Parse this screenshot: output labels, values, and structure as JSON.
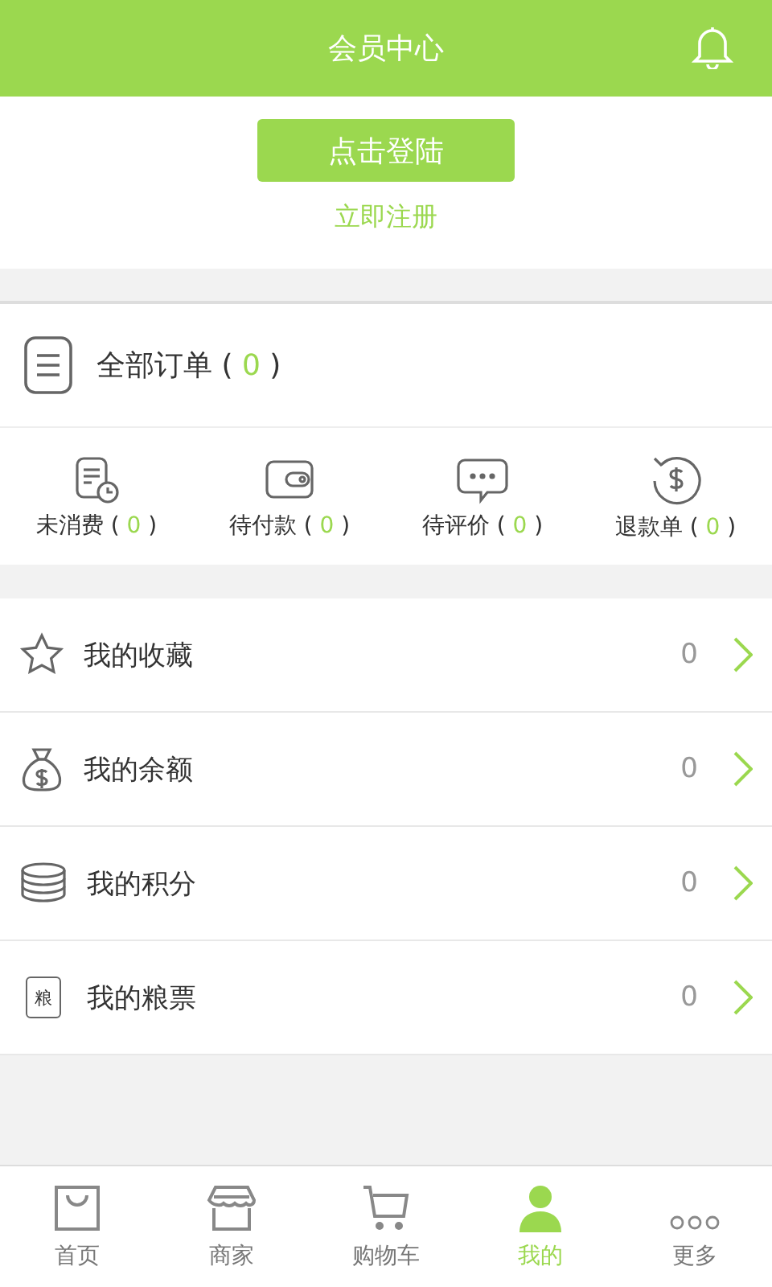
{
  "header": {
    "title": "会员中心"
  },
  "login": {
    "button": "点击登陆",
    "register": "立即注册"
  },
  "all_orders": {
    "prefix": "全部订单 ( ",
    "count": "0",
    "suffix": " )"
  },
  "order_statuses": [
    {
      "kind": "unused",
      "prefix": "未消费 ( ",
      "count": "0",
      "suffix": " )"
    },
    {
      "kind": "unpaid",
      "prefix": "待付款 ( ",
      "count": "0",
      "suffix": " )"
    },
    {
      "kind": "review",
      "prefix": "待评价 ( ",
      "count": "0",
      "suffix": " )"
    },
    {
      "kind": "refund",
      "prefix": "退款单 ( ",
      "count": "0",
      "suffix": " )"
    }
  ],
  "menu": [
    {
      "kind": "favorites",
      "label": "我的收藏",
      "value": "0"
    },
    {
      "kind": "balance",
      "label": "我的余额",
      "value": "0"
    },
    {
      "kind": "points",
      "label": "我的积分",
      "value": "0"
    },
    {
      "kind": "vouchers",
      "icon_text": "粮",
      "label": "我的粮票",
      "value": "0"
    }
  ],
  "tabs": [
    {
      "kind": "home",
      "label": "首页",
      "selected": false
    },
    {
      "kind": "shops",
      "label": "商家",
      "selected": false
    },
    {
      "kind": "cart",
      "label": "购物车",
      "selected": false
    },
    {
      "kind": "mine",
      "label": "我的",
      "selected": true
    },
    {
      "kind": "more",
      "label": "更多",
      "selected": false
    }
  ]
}
